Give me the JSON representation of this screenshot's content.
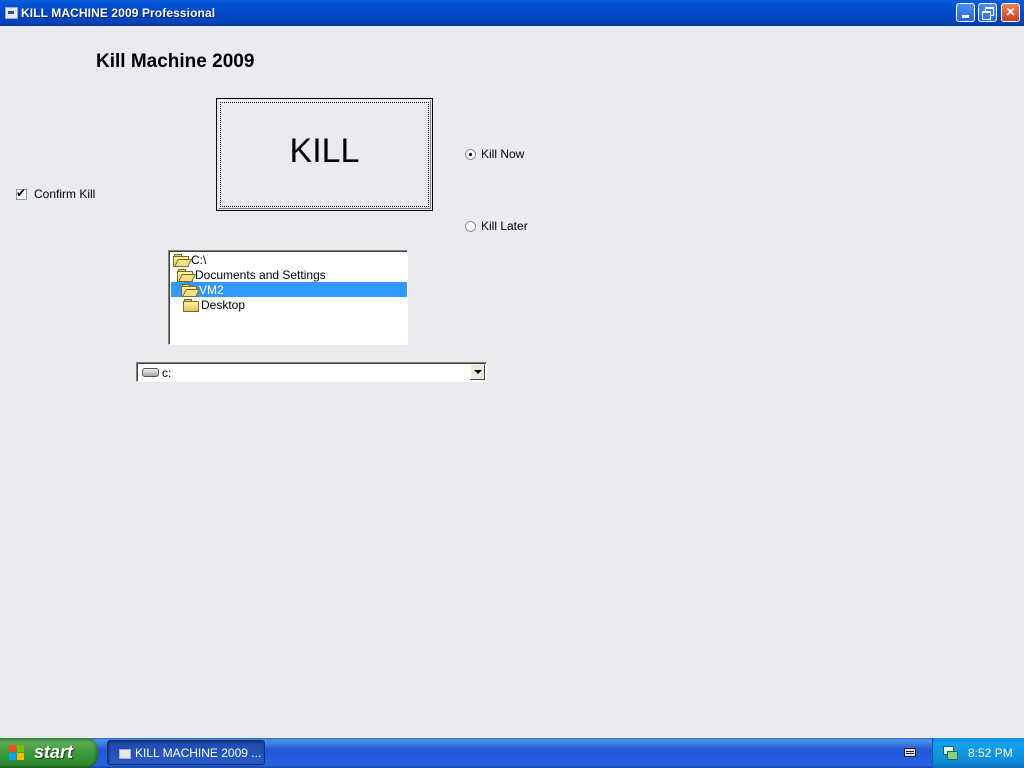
{
  "window": {
    "title": "KILL MACHINE 2009 Professional",
    "controls": {
      "minimize": "minimize-icon",
      "maximize": "restore-icon",
      "close": "close-icon"
    }
  },
  "app": {
    "heading": "Kill Machine 2009",
    "kill_button_label": "KILL",
    "confirm_kill": {
      "label": "Confirm Kill",
      "checked": true
    },
    "radios": [
      {
        "label": "Kill Now",
        "checked": true
      },
      {
        "label": "Kill Later",
        "checked": false
      }
    ],
    "directory_list": {
      "items": [
        {
          "label": "C:\\",
          "selected": false
        },
        {
          "label": "Documents and Settings",
          "selected": false
        },
        {
          "label": "VM2",
          "selected": true
        },
        {
          "label": "Desktop",
          "selected": false
        }
      ]
    },
    "drive_combo": {
      "value": "c:",
      "icon": "drive-icon"
    }
  },
  "taskbar": {
    "start_label": "start",
    "task_item_label": "KILL MACHINE 2009 ...",
    "clock": "8:52 PM"
  },
  "colors": {
    "titlebar": "#0048c8",
    "selection": "#3399ff",
    "start_button": "#3a9a3a",
    "taskbar": "#2157d7",
    "tray": "#0c8ad7",
    "client_bg": "#ebeaef"
  }
}
